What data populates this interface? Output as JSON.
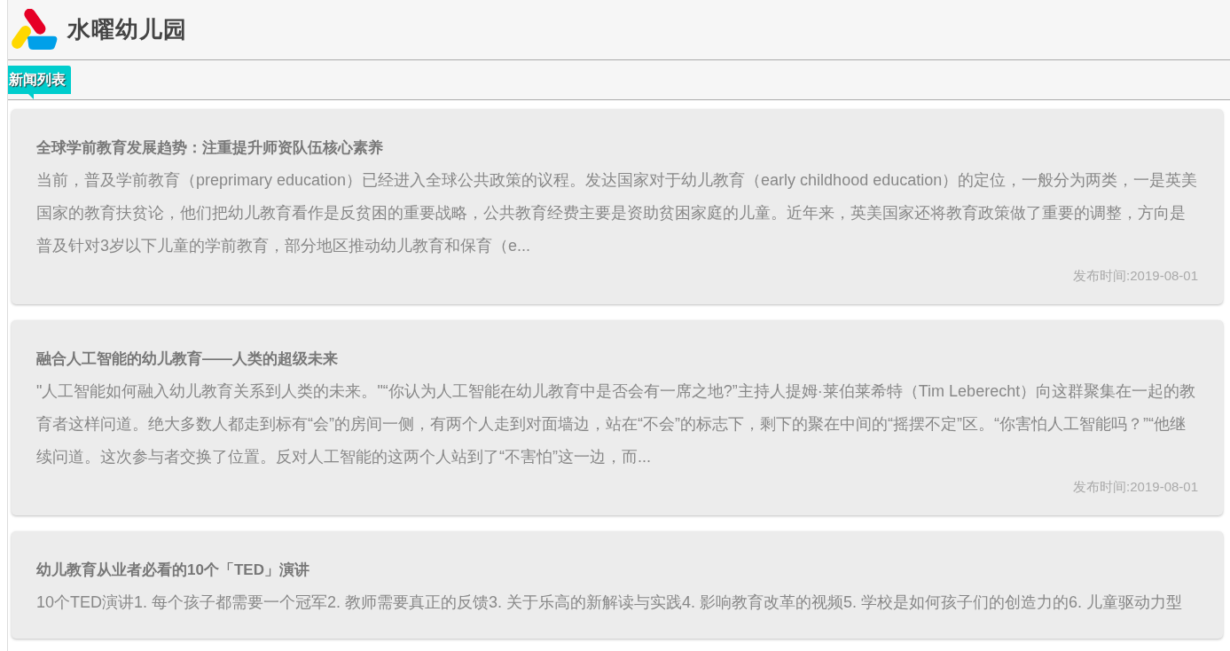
{
  "header": {
    "site_name": "水曜幼儿园"
  },
  "tabs": [
    {
      "label": "新闻列表",
      "selected": true
    }
  ],
  "news": [
    {
      "title": "全球学前教育发展趋势：注重提升师资队伍核心素养",
      "excerpt": "当前，普及学前教育（preprimary education）已经进入全球公共政策的议程。发达国家对于幼儿教育（early childhood education）的定位，一般分为两类，一是英美国家的教育扶贫论，他们把幼儿教育看作是反贫困的重要战略，公共教育经费主要是资助贫困家庭的儿童。近年来，英美国家还将教育政策做了重要的调整，方向是普及针对3岁以下儿童的学前教育，部分地区推动幼儿教育和保育（e...",
      "date": "发布时间:2019-08-01"
    },
    {
      "title": "融合人工智能的幼儿教育——人类的超级未来",
      "excerpt": "\"人工智能如何融入幼儿教育关系到人类的未来。\"“你认为人工智能在幼儿教育中是否会有一席之地?”主持人提姆·莱伯莱希特（Tim Leberecht）向这群聚集在一起的教育者这样问道。绝大多数人都走到标有“会”的房间一侧，有两个人走到对面墙边，站在“不会”的标志下，剩下的聚在中间的“摇摆不定”区。“你害怕人工智能吗？”“他继续问道。这次参与者交换了位置。反对人工智能的这两个人站到了“不害怕”这一边，而...",
      "date": "发布时间:2019-08-01"
    },
    {
      "title": "幼儿教育从业者必看的10个「TED」演讲",
      "excerpt": "10个TED演讲1. 每个孩子都需要一个冠军2. 教师需要真正的反馈3. 关于乐高的新解读与实践4. 影响教育改革的视频5. 学校是如何孩子们的创造力的6. 儿童驱动力型"
    }
  ]
}
